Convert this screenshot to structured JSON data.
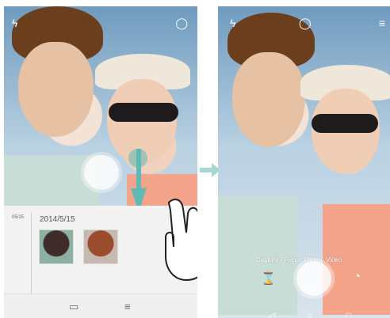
{
  "left_screen": {
    "drawer": {
      "date_short": "05/15",
      "date_long": "2014/5/15"
    }
  },
  "right_screen": {
    "modes": [
      "Capture / Focus",
      "Photo",
      "Video"
    ]
  },
  "icons": {
    "flash": "flash-icon",
    "chat": "chat-bubble-icon",
    "menu": "menu-icon",
    "gallery": "gallery-icon",
    "shutter": "shutter-button",
    "back": "back-icon",
    "home": "home-icon",
    "recent": "recent-apps-icon",
    "down_arrow": "swipe-down-arrow-icon",
    "right_arrow": "transition-arrow-icon",
    "hand": "touch-hand-icon",
    "timer": "timer-icon",
    "water_drop": "water-drop-icon"
  },
  "colors": {
    "accent_teal": "#5ebab2",
    "drawer_bg": "#f2f2f2"
  }
}
